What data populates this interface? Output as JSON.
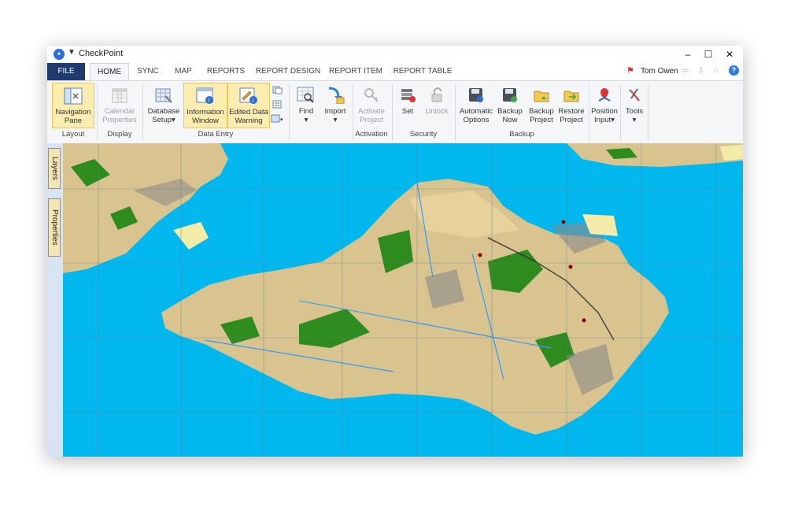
{
  "window": {
    "title": "CheckPoint"
  },
  "tabs": [
    {
      "label": "FILE"
    },
    {
      "label": "HOME"
    },
    {
      "label": "SYNC"
    },
    {
      "label": "MAP"
    },
    {
      "label": "REPORTS"
    },
    {
      "label": "REPORT DESIGN"
    },
    {
      "label": "REPORT ITEM"
    },
    {
      "label": "REPORT TABLE"
    }
  ],
  "user": {
    "name": "Tom Owen"
  },
  "ribbon": {
    "buttons": {
      "navigation_pane": [
        "Navigation",
        "Pane"
      ],
      "calendar_properties": [
        "Calendar",
        "Properties"
      ],
      "database_setup": [
        "Database",
        "Setup▾"
      ],
      "information_window": [
        "Information",
        "Window"
      ],
      "edited_data_warning": [
        "Edited Data",
        "Warning"
      ],
      "find": [
        "Find",
        "▾"
      ],
      "import": [
        "Import",
        "▾"
      ],
      "activate_project": [
        "Activate",
        "Project"
      ],
      "set": [
        "Set",
        ""
      ],
      "unlock": [
        "Unlock",
        ""
      ],
      "automatic_options": [
        "Automatic",
        "Options"
      ],
      "backup_now": [
        "Backup",
        "Now"
      ],
      "backup_project": [
        "Backup",
        "Project"
      ],
      "restore_project": [
        "Restore",
        "Project"
      ],
      "position_input": [
        "Position",
        "Input▾"
      ],
      "tools": [
        "Tools",
        "▾"
      ]
    },
    "groups": {
      "layout": "Layout",
      "display": "Display",
      "data_entry": "Data Entry",
      "activation": "Activation",
      "security": "Security",
      "backup": "Backup"
    }
  },
  "side_tabs": {
    "layers": "Layers",
    "properties": "Properties"
  },
  "colors": {
    "sea": "#00b7ee",
    "land": "#d9c48f",
    "woodland": "#2e8b1e",
    "urban": "#8a8a8a",
    "accent": "#1e3a6e",
    "highlight": "#fbecb0"
  }
}
